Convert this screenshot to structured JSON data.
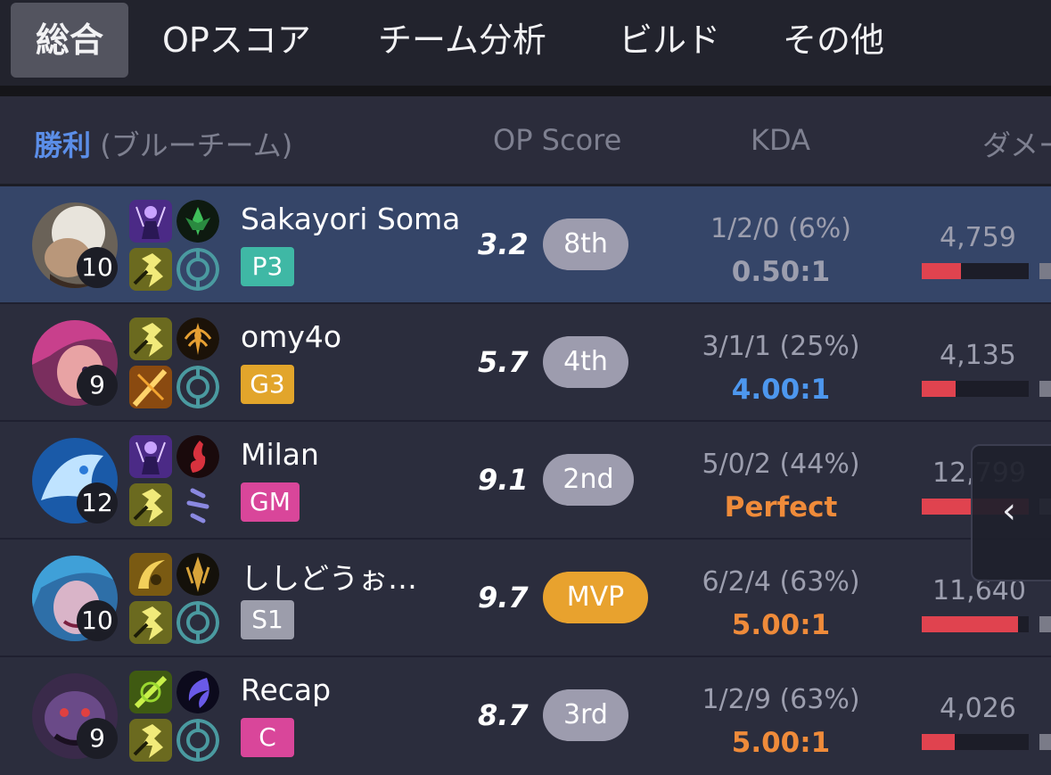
{
  "tabs": [
    {
      "label": "総合",
      "active": true
    },
    {
      "label": "OPスコア"
    },
    {
      "label": "チーム分析"
    },
    {
      "label": "ビルド"
    },
    {
      "label": "その他"
    }
  ],
  "table_header": {
    "result": "勝利",
    "team": "(ブルーチーム)",
    "op_score": "OP Score",
    "kda": "KDA",
    "damage": "ダメー"
  },
  "players": [
    {
      "name": "Sakayori Soma",
      "level": "10",
      "tier": "P3",
      "tier_color": "#3fb8a5",
      "op_score": "3.2",
      "rank": "8th",
      "kda": "1/2/0 (6%)",
      "ratio": "0.50:1",
      "ratio_color": "#9c9eae",
      "damage": "4,759",
      "damage_fraction": 0.37,
      "highlight": true
    },
    {
      "name": "omy4o",
      "level": "9",
      "tier": "G3",
      "tier_color": "#e2a52b",
      "op_score": "5.7",
      "rank": "4th",
      "kda": "3/1/1 (25%)",
      "ratio": "4.00:1",
      "ratio_color": "#4d97ee",
      "damage": "4,135",
      "damage_fraction": 0.32
    },
    {
      "name": "Milan",
      "level": "12",
      "tier": "GM",
      "tier_color": "#d9469a",
      "op_score": "9.1",
      "rank": "2nd",
      "kda": "5/0/2 (44%)",
      "ratio": "Perfect",
      "ratio_color": "#ef8b3a",
      "damage": "12,799",
      "damage_fraction": 1.0
    },
    {
      "name": "ししどうぉ…",
      "level": "10",
      "tier": "S1",
      "tier_color": "#9c9dab",
      "op_score": "9.7",
      "rank": "MVP",
      "kda": "6/2/4 (63%)",
      "ratio": "5.00:1",
      "ratio_color": "#ef8b3a",
      "damage": "11,640",
      "damage_fraction": 0.9
    },
    {
      "name": "Recap",
      "level": "9",
      "tier": "C",
      "tier_color": "#d9469a",
      "op_score": "8.7",
      "rank": "3rd",
      "kda": "1/2/9 (63%)",
      "ratio": "5.00:1",
      "ratio_color": "#ef8b3a",
      "damage": "4,026",
      "damage_fraction": 0.31
    }
  ],
  "icons": {
    "scroll_back": "chevron-left-icon"
  }
}
